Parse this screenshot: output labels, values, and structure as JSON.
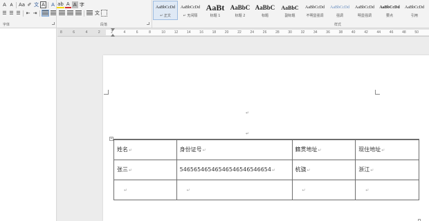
{
  "ribbon": {
    "font_buttons": [
      {
        "name": "grow-font",
        "glyph": "A"
      },
      {
        "name": "shrink-font",
        "glyph": "A"
      },
      {
        "name": "change-case",
        "glyph": "Aa"
      },
      {
        "name": "clear-format",
        "glyph": "✐"
      },
      {
        "name": "phonetic-guide",
        "glyph": "文"
      },
      {
        "name": "char-border",
        "glyph": "A"
      },
      {
        "name": "text-effect",
        "glyph": "A"
      },
      {
        "name": "highlight",
        "glyph": "ab"
      },
      {
        "name": "font-color",
        "glyph": "A"
      },
      {
        "name": "char-shading",
        "glyph": "A"
      },
      {
        "name": "enclose-char",
        "glyph": "字"
      }
    ],
    "para_buttons": [
      {
        "name": "bullets",
        "glyph": "☰"
      },
      {
        "name": "numbering",
        "glyph": "☰"
      },
      {
        "name": "multilevel",
        "glyph": "☰"
      },
      {
        "name": "decrease-indent",
        "glyph": "⇤"
      },
      {
        "name": "increase-indent",
        "glyph": "⇥"
      },
      {
        "name": "chinese-layout",
        "glyph": "文"
      },
      {
        "name": "sort",
        "glyph": "↓"
      },
      {
        "name": "show-marks",
        "glyph": "¶"
      }
    ],
    "styles": [
      {
        "preview": "AaBbCcDd",
        "name": "↵ 正文",
        "size": 6,
        "bold": false,
        "selected": true
      },
      {
        "preview": "AaBbCcDd",
        "name": "↵ 无间隔",
        "size": 6,
        "bold": false,
        "selected": false
      },
      {
        "preview": "AaBt",
        "name": "标题 1",
        "size": 12,
        "bold": true,
        "selected": false
      },
      {
        "preview": "AaBbC",
        "name": "标题 2",
        "size": 9,
        "bold": true,
        "selected": false
      },
      {
        "preview": "AaBbC",
        "name": "标题",
        "size": 9,
        "bold": true,
        "selected": false
      },
      {
        "preview": "AaBbC",
        "name": "副标题",
        "size": 8,
        "bold": true,
        "selected": false
      },
      {
        "preview": "AaBbCcDd",
        "name": "不明显强调",
        "size": 6,
        "bold": false,
        "selected": false
      },
      {
        "preview": "AaBbCcDd",
        "name": "强调",
        "size": 6,
        "bold": false,
        "selected": false
      },
      {
        "preview": "AaBbCcDd",
        "name": "明显强调",
        "size": 6,
        "bold": false,
        "selected": false
      },
      {
        "preview": "AaBbCcDd",
        "name": "要点",
        "size": 6,
        "bold": true,
        "selected": false
      },
      {
        "preview": "AaBbCcDd",
        "name": "引用",
        "size": 6,
        "bold": false,
        "selected": false
      }
    ],
    "group_labels": {
      "font": "字体",
      "paragraph": "段落",
      "styles": "样式"
    }
  },
  "ruler": {
    "numbers": [
      "8",
      "6",
      "4",
      "2",
      "2",
      "4",
      "6",
      "8",
      "10",
      "12",
      "14",
      "16",
      "18",
      "20",
      "22",
      "24",
      "26",
      "28",
      "30",
      "32",
      "34",
      "36",
      "38",
      "40",
      "42",
      "44",
      "46",
      "48",
      "50"
    ]
  },
  "document": {
    "table": {
      "rows": [
        [
          "姓名",
          "身份证号",
          "籍贯地址",
          "现住地址"
        ],
        [
          "张三",
          "54656546546546546546546654",
          "杭骁",
          "浙江"
        ],
        [
          "",
          "",
          "",
          ""
        ]
      ]
    },
    "paragraph_mark": "↵"
  },
  "colors": {
    "accent": "#2b5797",
    "highlight": "#f5d600",
    "font_color": "#d32f2f"
  }
}
